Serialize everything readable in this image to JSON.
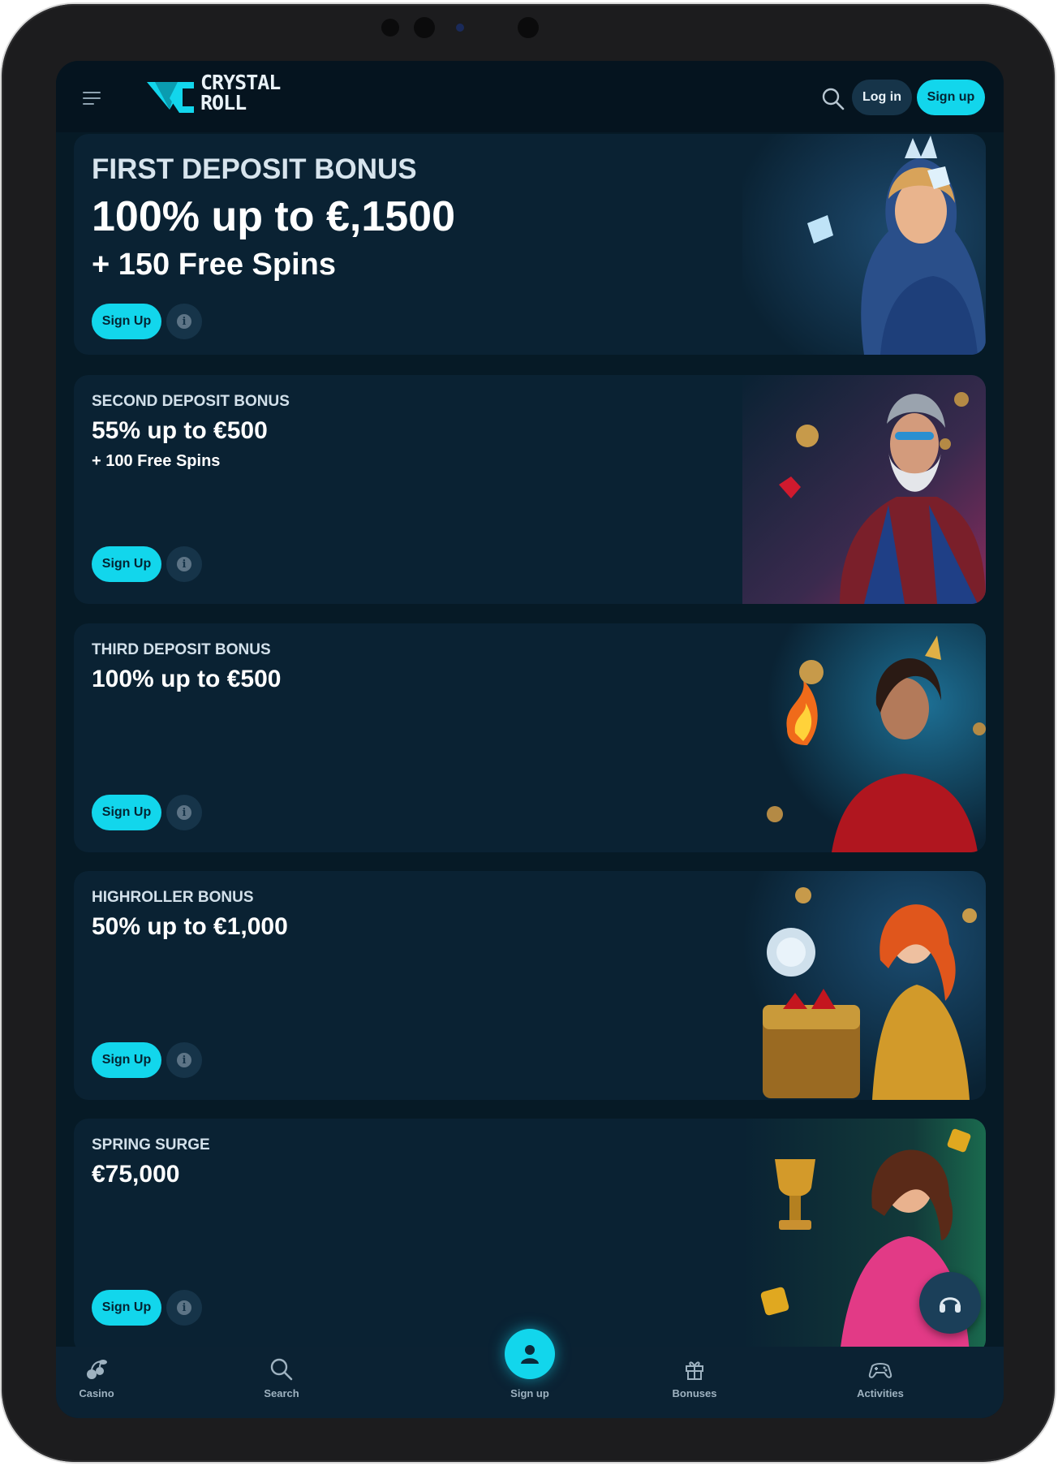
{
  "header": {
    "brand_line1": "CRYSTAL",
    "brand_line2": "ROLL",
    "login_label": "Log in",
    "signup_label": "Sign up"
  },
  "cards": [
    {
      "eyebrow": "FIRST DEPOSIT BONUS",
      "title": "100% up to €,1500",
      "subtitle": "+ 150 Free Spins",
      "button": "Sign Up",
      "info": "i"
    },
    {
      "eyebrow": "SECOND DEPOSIT BONUS",
      "title": "55% up to €500",
      "subtitle": "+ 100 Free Spins",
      "button": "Sign Up",
      "info": "i"
    },
    {
      "eyebrow": "THIRD DEPOSIT BONUS",
      "title": "100% up to €500",
      "subtitle": "",
      "button": "Sign Up",
      "info": "i"
    },
    {
      "eyebrow": "HIGHROLLER BONUS",
      "title": "50% up to €1,000",
      "subtitle": "",
      "button": "Sign Up",
      "info": "i"
    },
    {
      "eyebrow": "SPRING SURGE",
      "title": "€75,000",
      "subtitle": "",
      "button": "Sign Up",
      "info": "i"
    }
  ],
  "bottom_nav": [
    {
      "label": "Casino",
      "icon": "cherries-icon"
    },
    {
      "label": "Search",
      "icon": "search-icon"
    },
    {
      "label": "Sign up",
      "icon": "user-icon"
    },
    {
      "label": "Bonuses",
      "icon": "gift-icon"
    },
    {
      "label": "Activities",
      "icon": "gamepad-icon"
    }
  ],
  "colors": {
    "accent": "#12d6ec",
    "background": "#061a26",
    "card": "#0a2233",
    "secondary_button": "#163449"
  }
}
